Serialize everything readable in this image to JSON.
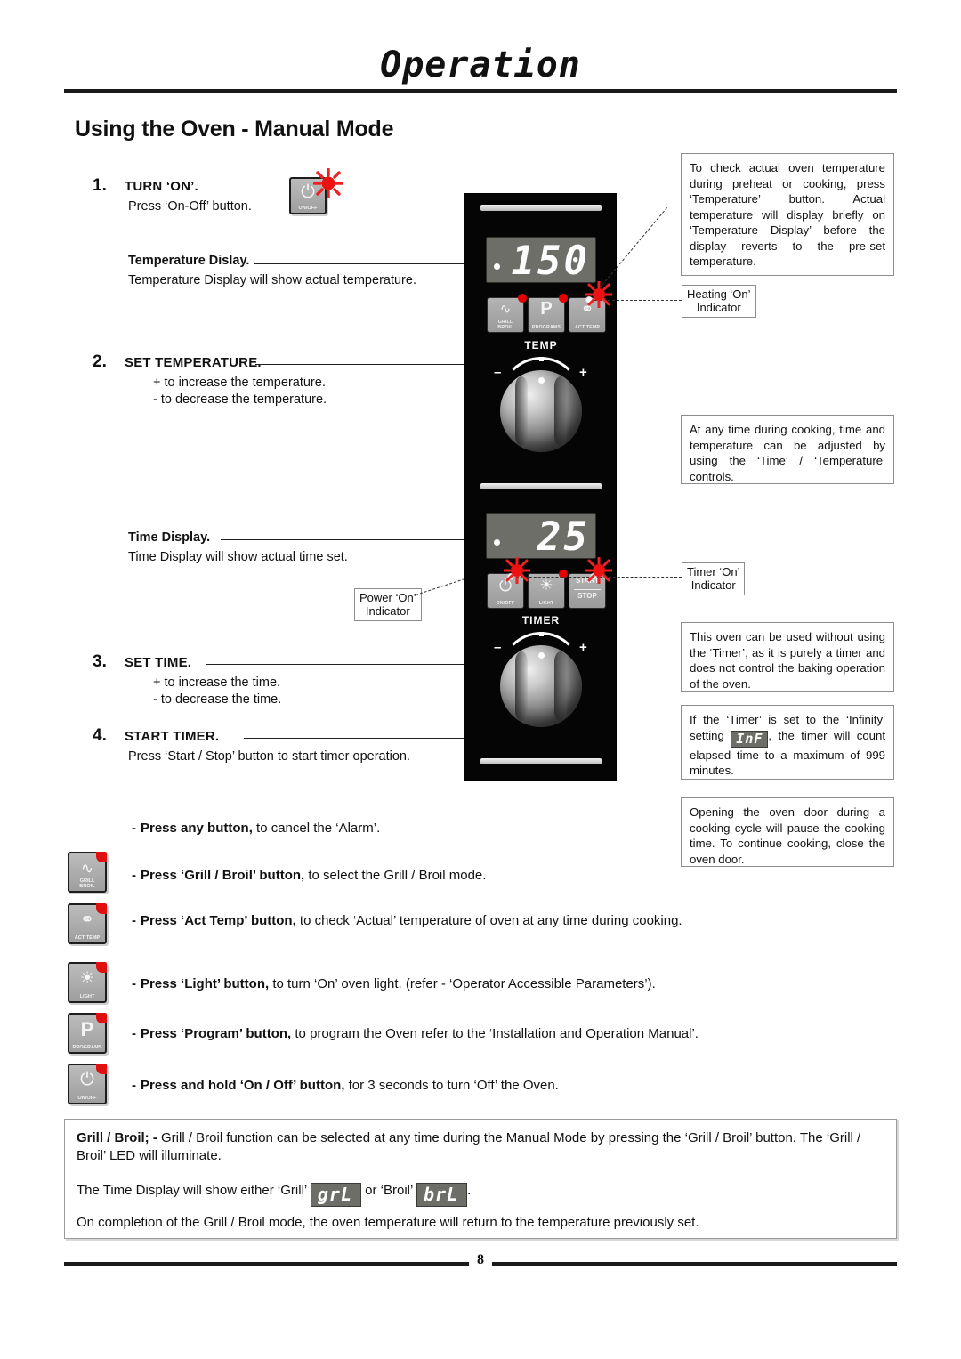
{
  "header": {
    "title": "Operation",
    "section_title": "Using the Oven - Manual Mode"
  },
  "steps": [
    {
      "number": "1.",
      "heading": "TURN ‘ON’.",
      "body": "Press ‘On-Off’ button."
    },
    {
      "number": "2.",
      "heading": "SET TEMPERATURE.",
      "line1": "+ to increase the temperature.",
      "line2": "- to decrease the temperature."
    },
    {
      "number": "3.",
      "heading": "SET TIME.",
      "line1": "+ to increase the time.",
      "line2": "- to decrease the time."
    },
    {
      "number": "4.",
      "heading": "START TIMER.",
      "body": "Press ‘Start / Stop’ button to start timer operation."
    }
  ],
  "labels": {
    "temp_display_head": "Temperature Dislay.",
    "temp_display_body": "Temperature Display will show actual temperature.",
    "time_display_head": "Time Display.",
    "time_display_body": "Time Display will show actual time set."
  },
  "tags": {
    "heating_on_line1": "Heating ‘On’",
    "heating_on_line2": "Indicator",
    "power_on_line1": "Power ‘On’",
    "power_on_line2": "Indicator",
    "timer_on_line1": "Timer ‘On’",
    "timer_on_line2": "Indicator"
  },
  "callouts": {
    "actual_temp": "To check actual oven temperature during preheat or cooking, press ‘Temperature’ button.   Actual temperature will display briefly on ‘Temperature Display’ before the display reverts to the pre-set temperature.",
    "adjust_anytime": "At any time during cooking, time and temperature can be adjusted by using the ‘Time’ / ‘Temperature’ controls.",
    "timer_optional": "This oven can be used without using the ‘Timer’, as it is purely a timer and does not control the baking operation of the oven.",
    "infinity_pre": "If the ‘Timer’ is set to the ‘Infinity’ setting",
    "infinity_seg": "InF",
    "infinity_post": ", the timer will count elapsed time to a maximum of 999 minutes.",
    "door_open": "Opening the oven door during a cooking cycle will pause the cooking time.   To continue cooking, close the oven door."
  },
  "panel": {
    "temperature_value": "150",
    "time_value": "25",
    "temp_knob_label": "TEMP",
    "timer_knob_label": "TIMER",
    "minus": "–",
    "plus": "+",
    "buttons": {
      "grill_broil_line1": "GRILL",
      "grill_broil_line2": "BROIL",
      "programs_glyph": "P",
      "programs_cap": "PROGRAMS",
      "act_temp_cap": "ACT TEMP",
      "on_off_cap": "ON/OFF",
      "light_cap": "LIGHT",
      "start_label": "START",
      "stop_label": "STOP"
    }
  },
  "on_off_icon": {
    "cap": "ON/OFF"
  },
  "bullets": [
    {
      "bold": "Press any button,",
      "rest": " to cancel the ‘Alarm’.",
      "icon": null
    },
    {
      "bold": "Press ‘Grill / Broil’ button,",
      "rest": "  to select the Grill / Broil mode.",
      "icon": "grill-broil"
    },
    {
      "bold": "Press ‘Act Temp’ button,",
      "rest": "  to check ‘Actual’ temperature of oven at any time during cooking.",
      "icon": "act-temp"
    },
    {
      "bold": "Press ‘Light’ button,",
      "rest": " to turn ‘On’ oven light.  (refer - ‘Operator Accessible Parameters’).",
      "icon": "light"
    },
    {
      "bold": "Press ‘Program’ button,",
      "rest": " to program the Oven refer to the ‘Installation and Operation Manual’.",
      "icon": "programs"
    },
    {
      "bold": "Press and hold ‘On / Off’ button,",
      "rest": " for 3 seconds to turn ‘Off’ the Oven.",
      "icon": "on-off"
    }
  ],
  "side_buttons": {
    "grill_line1": "GRILL",
    "grill_line2": "BROIL",
    "act_temp_cap": "ACT TEMP",
    "light_cap": "LIGHT",
    "programs_cap": "PROGRAMS",
    "on_off_cap": "ON/OFF",
    "programs_glyph": "P"
  },
  "grill_box": {
    "lead_bold": "Grill / Broil; -",
    "lead_rest": " Grill / Broil function can be selected at any time during the Manual Mode by pressing the ‘Grill / Broil’ button. The ‘Grill / Broil’ LED will illuminate.",
    "line2_pre": "The Time Display will show either ‘Grill’",
    "line2_seg1": "grL",
    "line2_mid": "or ‘Broil’",
    "line2_seg2": "brL",
    "line2_post": ".",
    "line3": "On completion of the Grill / Broil mode, the oven temperature will return to the temperature previously set."
  },
  "footer": {
    "page_number": "8"
  },
  "colors": {
    "led_red": "#e60000",
    "panel_black": "#050505",
    "display_grey": "#6e6e68",
    "button_grey": "#a8a8a8"
  }
}
